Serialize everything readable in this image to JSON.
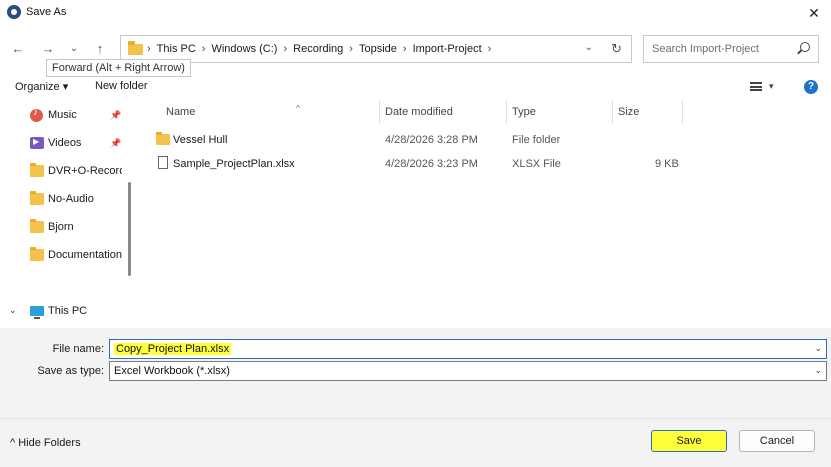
{
  "window": {
    "title": "Save As",
    "close_glyph": "✕"
  },
  "nav": {
    "back_glyph": "←",
    "forward_glyph": "→",
    "recent_glyph": "⌄",
    "up_glyph": "↑",
    "tooltip": "Forward (Alt + Right Arrow)"
  },
  "address": {
    "crumbs": [
      "This PC",
      "Windows (C:)",
      "Recording",
      "Topside",
      "Import-Project"
    ],
    "separator": "›",
    "dropdown_glyph": "⌄",
    "refresh_glyph": "↻"
  },
  "search": {
    "placeholder": "Search Import-Project"
  },
  "toolbar": {
    "organize": "Organize ▾",
    "new_folder": "New folder",
    "view_caret": "▾",
    "help": "?"
  },
  "sidebar": {
    "items": [
      {
        "label": "Music",
        "icon": "music-icon",
        "pinned": true
      },
      {
        "label": "Videos",
        "icon": "video-icon",
        "pinned": true
      },
      {
        "label": "DVR+O-Recordi",
        "icon": "folder-icon",
        "pinned": false
      },
      {
        "label": "No-Audio",
        "icon": "folder-icon",
        "pinned": false
      },
      {
        "label": "Bjorn",
        "icon": "folder-icon",
        "pinned": false
      },
      {
        "label": "Documentation",
        "icon": "folder-icon",
        "pinned": false
      }
    ],
    "this_pc": {
      "label": "This PC",
      "caret": "⌄"
    },
    "pin_glyph": "📌"
  },
  "files": {
    "columns": {
      "name": "Name",
      "date": "Date modified",
      "type": "Type",
      "size": "Size"
    },
    "sort_glyph": "^",
    "rows": [
      {
        "name": "Vessel Hull",
        "date": "4/28/2026 3:28 PM",
        "type": "File folder",
        "size": "",
        "kind": "folder"
      },
      {
        "name": "Sample_ProjectPlan.xlsx",
        "date": "4/28/2026 3:23 PM",
        "type": "XLSX File",
        "size": "9 KB",
        "kind": "file"
      }
    ]
  },
  "form": {
    "file_name_label": "File name:",
    "file_name_value": "Copy_Project Plan.xlsx",
    "save_type_label": "Save as type:",
    "save_type_value": "Excel Workbook (*.xlsx)",
    "caret": "⌄"
  },
  "footer": {
    "hide_folders": "Hide Folders",
    "hide_caret": "^",
    "save": "Save",
    "cancel": "Cancel"
  },
  "colors": {
    "highlight": "#ffff3a",
    "accent": "#2c6fbf",
    "help": "#1a73c9"
  }
}
